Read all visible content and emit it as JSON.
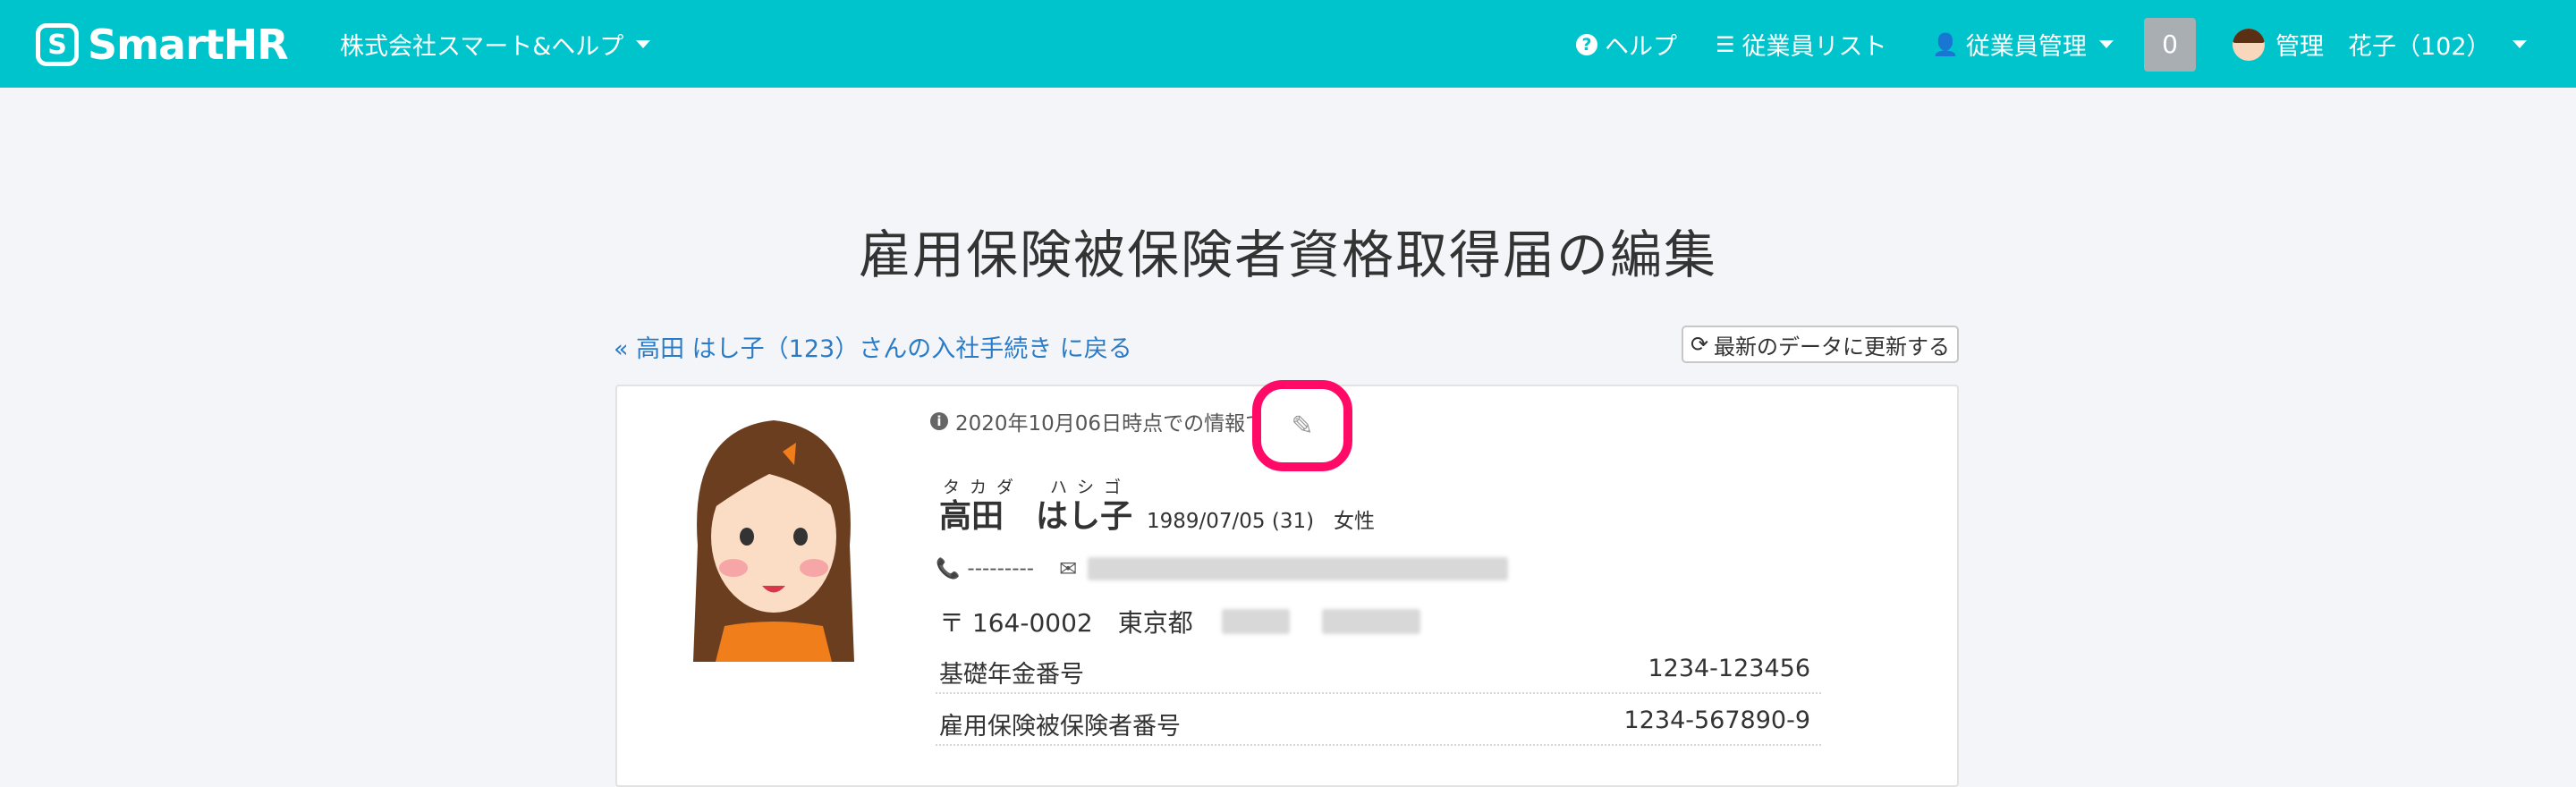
{
  "header": {
    "logo_text": "SmartHR",
    "company": "株式会社スマート&ヘルプ",
    "nav": {
      "help": "ヘルプ",
      "employee_list": "従業員リスト",
      "employee_mgmt": "従業員管理"
    },
    "notification_count": "0",
    "user": "管理　花子（102）"
  },
  "page": {
    "title": "雇用保険被保険者資格取得届の編集",
    "back_link": "« 高田 はし子（123）さんの入社手続き に戻る",
    "refresh_button": "最新のデータに更新する"
  },
  "card": {
    "info_note": "2020年10月06日時点での情報です",
    "name_ruby": "タカダ　ハシゴ",
    "name": "高田　はし子",
    "birth_age": "1989/07/05 (31)",
    "gender": "女性",
    "phone": "---------",
    "postal": "〒 164-0002",
    "prefecture": "東京都",
    "rows": [
      {
        "label": "基礎年金番号",
        "value": "1234-123456"
      },
      {
        "label": "雇用保険被保険者番号",
        "value": "1234-567890-9"
      }
    ]
  },
  "colors": {
    "header_bg": "#00c4cc",
    "link": "#2b7cc6",
    "highlight_ring": "#ff0a67"
  }
}
